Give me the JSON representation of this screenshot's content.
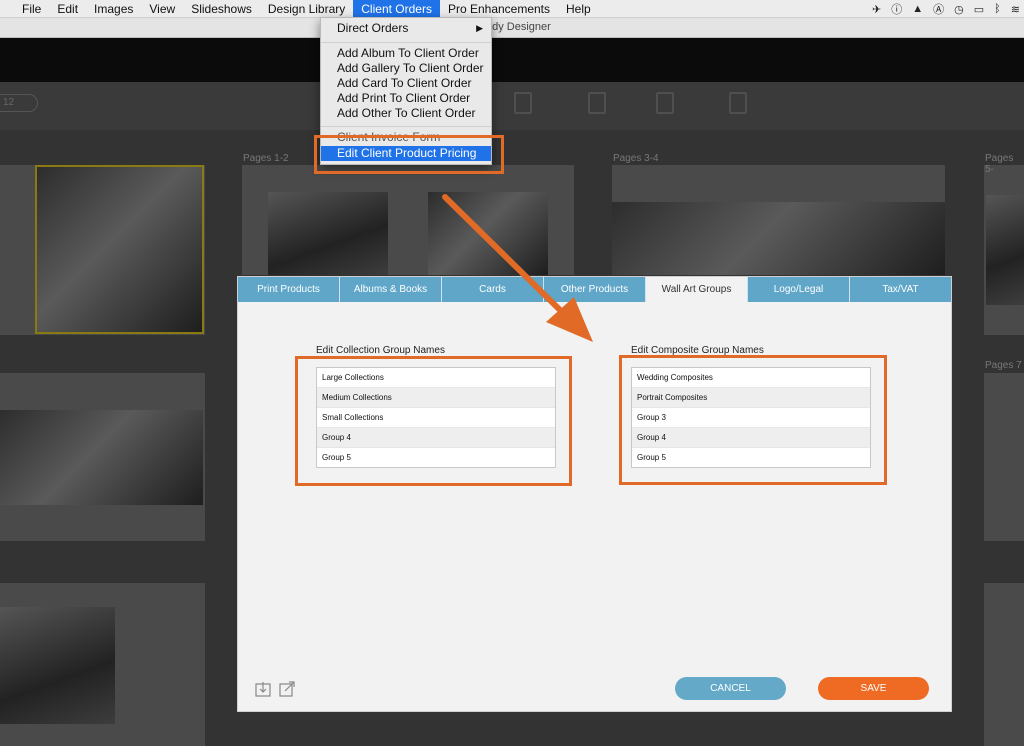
{
  "menubar": {
    "items": [
      "File",
      "Edit",
      "Images",
      "View",
      "Slideshows",
      "Design Library",
      "Client Orders",
      "Pro Enhancements",
      "Help"
    ],
    "active_index": 6,
    "status_icons": [
      "airplane-icon",
      "info-icon",
      "google-drive-icon",
      "app-store-icon",
      "time-machine-icon",
      "airplay-icon",
      "bluetooth-icon",
      "wifi-icon"
    ]
  },
  "window": {
    "title": "Fundy Designer"
  },
  "toolbar": {
    "pill_text": "12"
  },
  "pages": {
    "p12": "Pages 1-2",
    "p34": "Pages 3-4",
    "p56": "Pages 5-",
    "p7": "Pages 7"
  },
  "dropdown": {
    "items": [
      {
        "label": "Direct Orders",
        "submenu": true
      },
      {
        "label": "Add Album To Client Order"
      },
      {
        "label": "Add Gallery To Client Order"
      },
      {
        "label": "Add Card To Client Order"
      },
      {
        "label": "Add Print To Client Order"
      },
      {
        "label": "Add Other To Client Order"
      },
      {
        "label": "Client Invoice Form"
      },
      {
        "label": "Edit Client Product Pricing",
        "highlighted": true
      }
    ],
    "submenu_arrow": "▶"
  },
  "dialog": {
    "tabs": [
      "Print Products",
      "Albums & Books",
      "Cards",
      "Other Products",
      "Wall Art Groups",
      "Logo/Legal",
      "Tax/VAT"
    ],
    "active_tab": 4,
    "collection": {
      "title": "Edit Collection Group Names",
      "items": [
        "Large Collections",
        "Medium Collections",
        "Small Collections",
        "Group 4",
        "Group 5"
      ]
    },
    "composite": {
      "title": "Edit Composite Group Names",
      "items": [
        "Wedding Composites",
        "Portrait Composites",
        "Group 3",
        "Group 4",
        "Group 5"
      ]
    },
    "buttons": {
      "cancel": "CANCEL",
      "save": "SAVE"
    },
    "footer_icons": [
      "import-icon",
      "export-icon"
    ]
  },
  "colors": {
    "menu_highlight": "#1f72e8",
    "tab_bar": "#5fa6c8",
    "cancel_button": "#64a9c8",
    "save_button": "#ef6a23",
    "annotation": "#e06a26"
  }
}
